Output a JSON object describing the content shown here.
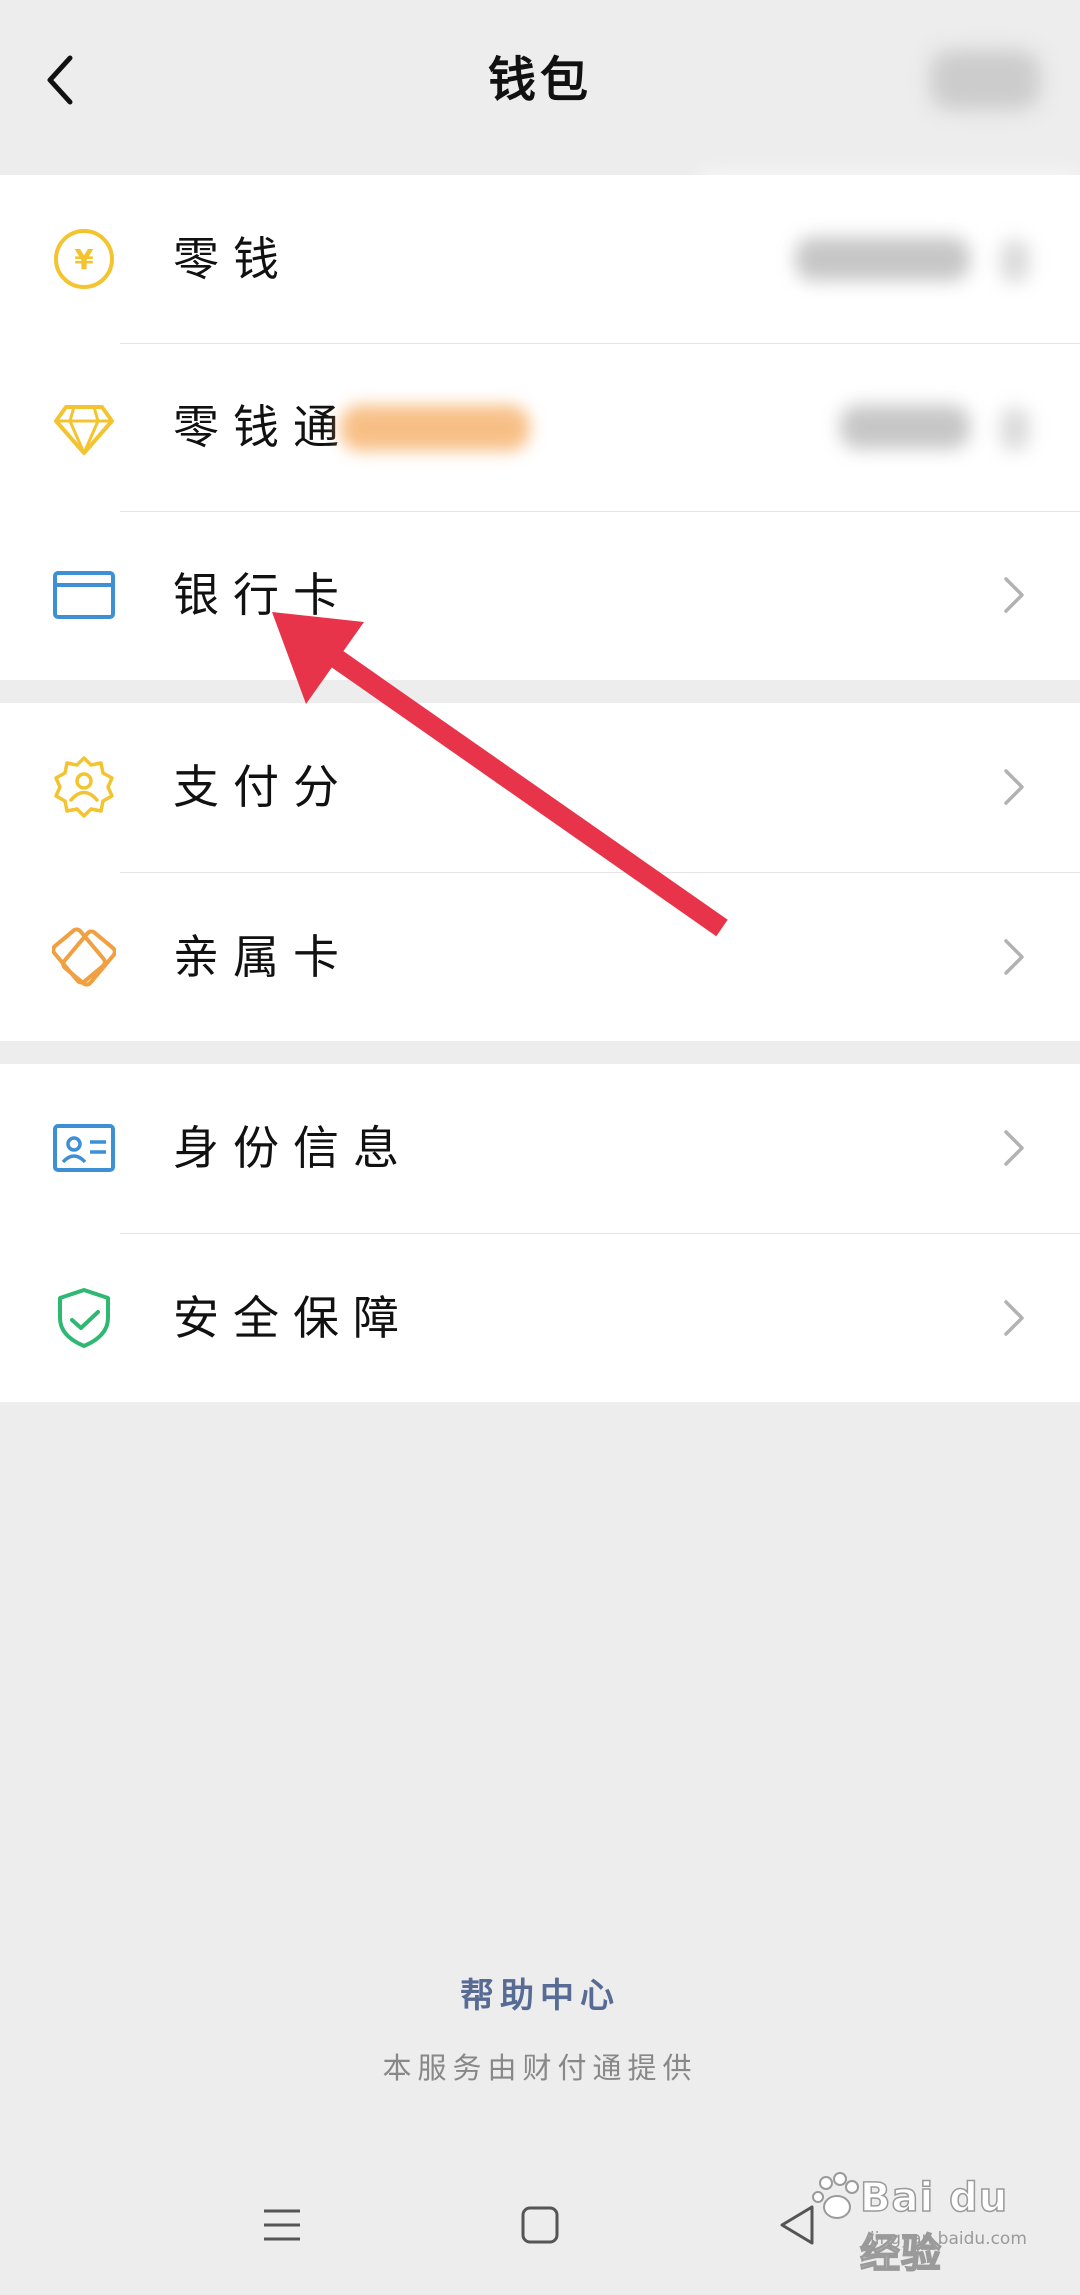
{
  "header": {
    "title": "钱包"
  },
  "groups": {
    "finance": {
      "change": {
        "label": "零钱",
        "icon": "yuan-coin-icon"
      },
      "licaitong": {
        "label": "零钱通",
        "icon": "diamond-icon"
      },
      "bank_card": {
        "label": "银行卡",
        "icon": "bank-card-icon"
      }
    },
    "credit": {
      "pay_score": {
        "label": "支付分",
        "icon": "badge-person-icon"
      },
      "family_card": {
        "label": "亲属卡",
        "icon": "linked-cards-icon"
      }
    },
    "account": {
      "identity": {
        "label": "身份信息",
        "icon": "id-card-icon"
      },
      "security": {
        "label": "安全保障",
        "icon": "shield-check-icon"
      }
    }
  },
  "footer": {
    "help_center": "帮助中心",
    "provider": "本服务由财付通提供"
  },
  "watermark": {
    "brand": "Bai du 经验",
    "url": "jingyan.baidu.com"
  },
  "colors": {
    "background": "#ededed",
    "card": "#ffffff",
    "link": "#576b95",
    "yellow_icon": "#f4c430",
    "blue_icon": "#3d8fd6",
    "orange_icon": "#f0a040",
    "green_icon": "#2eb872",
    "arrow": "#e8344a"
  }
}
